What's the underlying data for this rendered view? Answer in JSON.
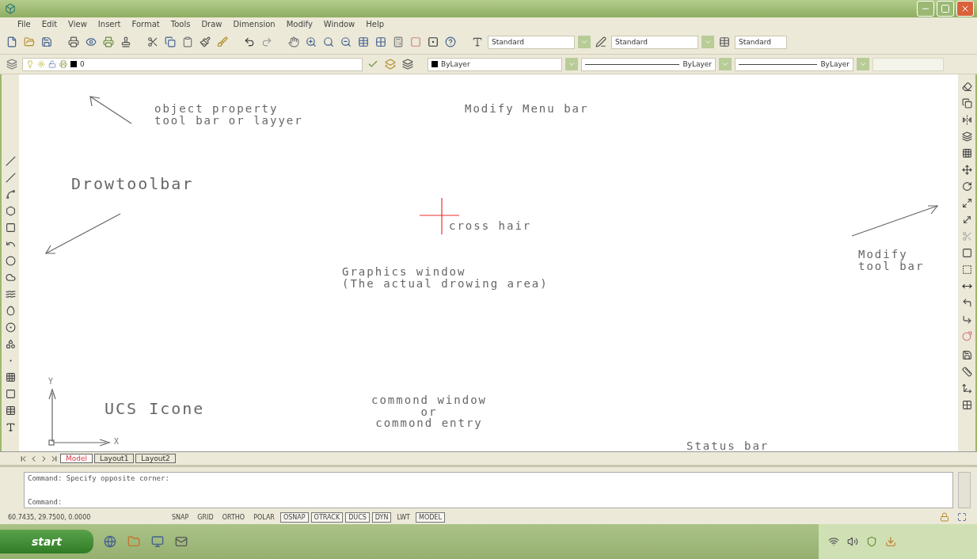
{
  "menu_bar": [
    "File",
    "Edit",
    "View",
    "Insert",
    "Format",
    "Tools",
    "Draw",
    "Dimension",
    "Modify",
    "Window",
    "Help"
  ],
  "style_toolbar": [
    {
      "value": "Standard"
    },
    {
      "value": "Standard"
    },
    {
      "value": "Standard"
    }
  ],
  "layers_toolbar": {
    "layer": "0",
    "color_setting": "ByLayer",
    "linetype": "ByLayer",
    "lineweight": "ByLayer"
  },
  "annotations": [
    {
      "kind": "note",
      "lines": [
        "object property",
        "tool bar or layyer"
      ]
    },
    {
      "kind": "note",
      "lines": [
        "Modify Menu bar"
      ]
    },
    {
      "kind": "title",
      "lines": [
        "Drowtoolbar"
      ]
    },
    {
      "kind": "note",
      "lines": [
        "cross hair"
      ]
    },
    {
      "kind": "note",
      "lines": [
        "Graphics window",
        "(The actual drowing area)"
      ]
    },
    {
      "kind": "note",
      "lines": [
        "Modify",
        "tool bar"
      ]
    },
    {
      "kind": "title",
      "lines": [
        "UCS Icone"
      ]
    },
    {
      "kind": "center",
      "lines": [
        "commond window",
        "or",
        "commond entry"
      ]
    },
    {
      "kind": "note",
      "lines": [
        "Status bar"
      ]
    }
  ],
  "ucs_icon": {
    "y_label": "Y",
    "x_label": "X"
  },
  "layout_tabs": [
    {
      "label": "Model",
      "selected": true
    },
    {
      "label": "Layout1",
      "selected": false
    },
    {
      "label": "Layout2",
      "selected": false
    }
  ],
  "command_window": [
    "Command: Specify opposite corner:",
    "Command:"
  ],
  "status_bar": {
    "coordinates": "60.7435, 29.7500, 0.0000",
    "toggles": [
      {
        "label": "SNAP",
        "on": false
      },
      {
        "label": "GRID",
        "on": false
      },
      {
        "label": "ORTHO",
        "on": false
      },
      {
        "label": "POLAR",
        "on": false
      },
      {
        "label": "OSNAP",
        "on": true
      },
      {
        "label": "OTRACK",
        "on": true
      },
      {
        "label": "DUCS",
        "on": true
      },
      {
        "label": "DYN",
        "on": true
      },
      {
        "label": "LWT",
        "on": false
      },
      {
        "label": "MODEL",
        "on": true
      }
    ]
  },
  "taskbar": {
    "start": "start"
  }
}
